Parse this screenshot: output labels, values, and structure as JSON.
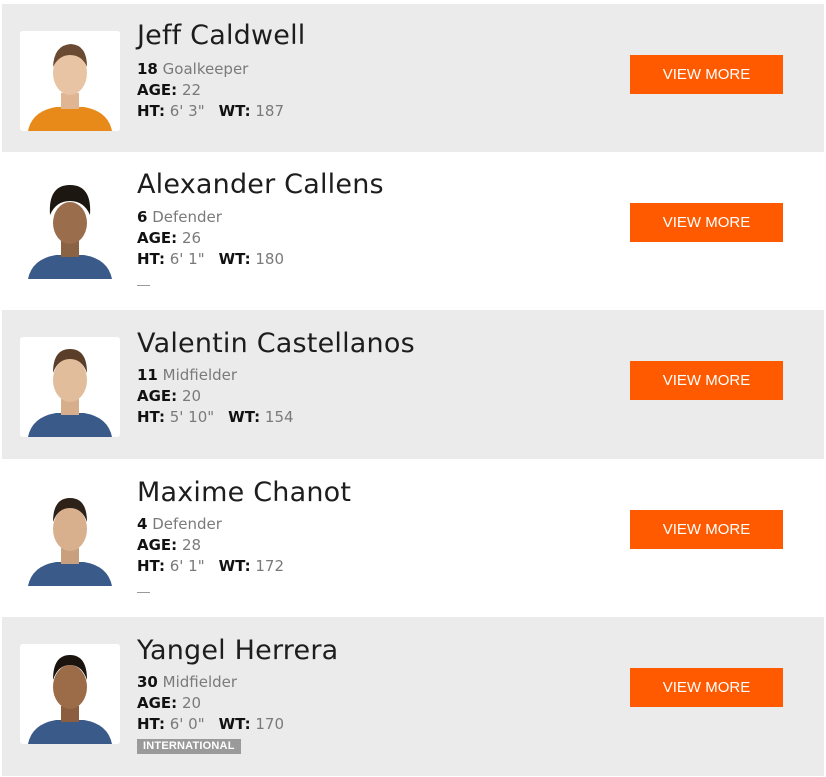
{
  "labels": {
    "age": "AGE:",
    "ht": "HT:",
    "wt": "WT:"
  },
  "button_label": "VIEW MORE",
  "colors": {
    "accent": "#ff5a00",
    "row_gray": "#ebebeb",
    "badge": "#9a9a9a"
  },
  "players": [
    {
      "name": "Jeff Caldwell",
      "number": "18",
      "position": "Goalkeeper",
      "age": "22",
      "height": "6' 3\"",
      "weight": "187",
      "tag": ""
    },
    {
      "name": "Alexander Callens",
      "number": "6",
      "position": "Defender",
      "age": "26",
      "height": "6' 1\"",
      "weight": "180",
      "tag": ""
    },
    {
      "name": "Valentin Castellanos",
      "number": "11",
      "position": "Midfielder",
      "age": "20",
      "height": "5' 10\"",
      "weight": "154",
      "tag": ""
    },
    {
      "name": "Maxime Chanot",
      "number": "4",
      "position": "Defender",
      "age": "28",
      "height": "6' 1\"",
      "weight": "172",
      "tag": ""
    },
    {
      "name": "Yangel Herrera",
      "number": "30",
      "position": "Midfielder",
      "age": "20",
      "height": "6' 0\"",
      "weight": "170",
      "tag": "INTERNATIONAL"
    }
  ]
}
